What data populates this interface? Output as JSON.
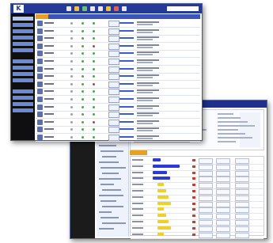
{
  "front_window": {
    "logo_text": "K",
    "toolbar_icons": [
      "icon",
      "icon",
      "icon",
      "icon",
      "icon",
      "icon",
      "icon",
      "icon"
    ],
    "toolbar_icon_colors": [
      "#e8e8e8",
      "#f0c040",
      "#70c070",
      "#e8e8e8",
      "#e8e8e8",
      "#f0c040",
      "#e06050",
      "#e8e8e8"
    ],
    "sidebar_items": 14,
    "rows": 16,
    "status_colors": [
      "#40b040",
      "#40b040",
      "#d03a2a"
    ]
  },
  "back_window": {
    "sidebar_items": 5,
    "tree_lines": 22,
    "grid_rows": 13,
    "bar_colors": [
      "#2a3ad8",
      "#f0d020"
    ]
  }
}
